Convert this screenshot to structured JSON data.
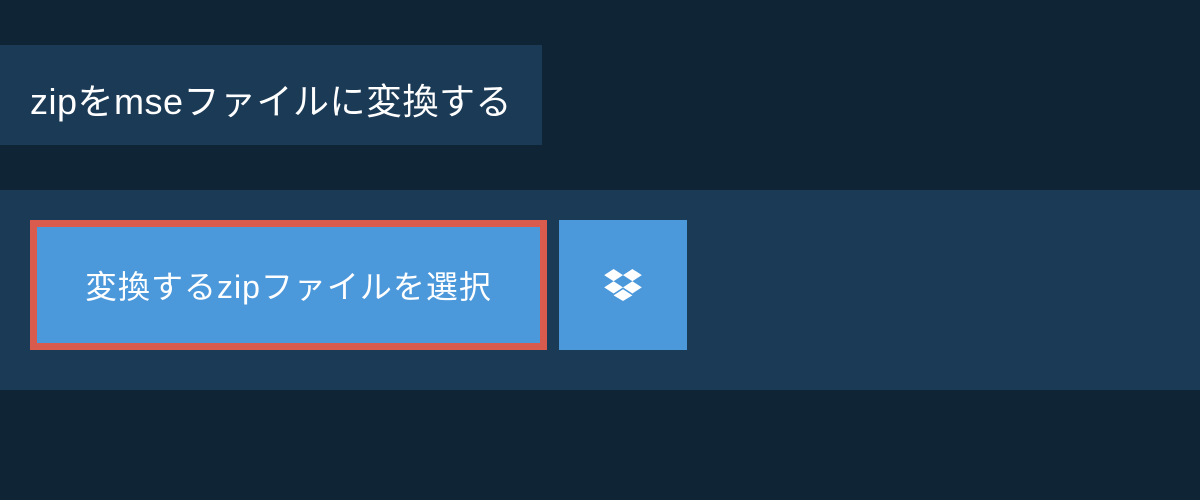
{
  "header": {
    "title": "zipをmseファイルに変換する"
  },
  "actions": {
    "select_file_label": "変換するzipファイルを選択",
    "dropbox_icon_name": "dropbox-icon"
  },
  "colors": {
    "background": "#0f2535",
    "panel": "#1b3a56",
    "button_blue": "#4b98db",
    "button_outline": "#d95b4d",
    "text": "#ffffff"
  }
}
